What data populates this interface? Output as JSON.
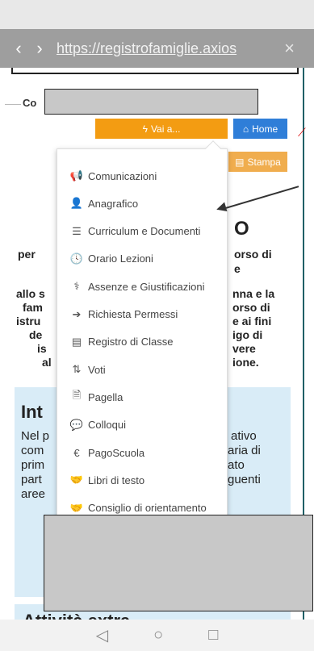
{
  "browser": {
    "back_icon": "‹",
    "forward_icon": "›",
    "url": "https://registrofamiglie.axios",
    "close_icon": "×"
  },
  "page": {
    "section_label": "Co",
    "vai_button": "Vai a...",
    "home_button": "Home",
    "stampa_button": "Stampa",
    "heading_fragment": "O",
    "bold_paragraph_1": [
      "per",
      "orso di",
      "e"
    ],
    "bold_paragraph_2_left": [
      "allo s",
      "fam",
      "istru",
      "de",
      "is",
      "al"
    ],
    "bold_paragraph_2_right": [
      "nna e la",
      "orso di",
      "e ai fini",
      "igo di",
      "vere",
      "ione."
    ],
    "intro": {
      "title": "Int",
      "left_lines": [
        "Nel p",
        "com",
        "prim",
        "part",
        "aree"
      ],
      "right_lines": [
        "ativo",
        "aria di",
        "ato",
        "guenti"
      ]
    },
    "extra_title": "Attività extra"
  },
  "menu": {
    "items": [
      {
        "icon": "megaphone-icon",
        "glyph": "📢",
        "label": "Comunicazioni"
      },
      {
        "icon": "user-icon",
        "glyph": "👤",
        "label": "Anagrafico"
      },
      {
        "icon": "list-icon",
        "glyph": "☰",
        "label": "Curriculum e Documenti"
      },
      {
        "icon": "clock-icon",
        "glyph": "🕓",
        "label": "Orario Lezioni"
      },
      {
        "icon": "stethoscope-icon",
        "glyph": "⚕",
        "label": "Assenze e Giustificazioni"
      },
      {
        "icon": "signin-icon",
        "glyph": "➔",
        "label": "Richiesta Permessi"
      },
      {
        "icon": "book-icon",
        "glyph": "▤",
        "label": "Registro di Classe"
      },
      {
        "icon": "sort-icon",
        "glyph": "⇅",
        "label": "Voti"
      },
      {
        "icon": "file-icon",
        "glyph": "🗎",
        "label": "Pagella"
      },
      {
        "icon": "comments-icon",
        "glyph": "💬",
        "label": "Colloqui"
      },
      {
        "icon": "euro-icon",
        "glyph": "€",
        "label": "PagoScuola"
      },
      {
        "icon": "handshake-icon",
        "glyph": "🤝",
        "label": "Libri di testo"
      },
      {
        "icon": "handshake-icon",
        "glyph": "🤝",
        "label": "Consiglio di orientamento"
      }
    ]
  },
  "android_nav": {
    "back": "◁",
    "home": "○",
    "recents": "□"
  },
  "colors": {
    "vai_orange": "#f39c12",
    "home_blue": "#2f7ed8",
    "stampa_orange": "#f0ad4e",
    "intro_bg": "#d9ecf7"
  }
}
